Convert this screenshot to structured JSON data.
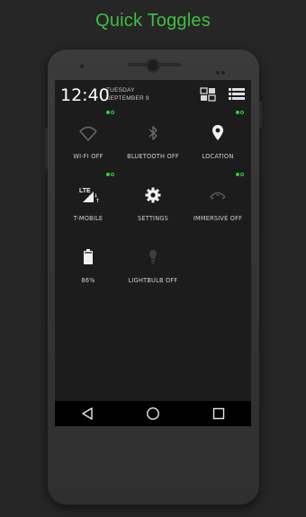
{
  "heading": "Quick Toggles",
  "colors": {
    "accent": "#3fbf3f",
    "indicator": "#2fcf3a",
    "screen_bg": "#1c1c1c"
  },
  "status_header": {
    "time": "12:40",
    "day": "TUESDAY",
    "date": "SEPTEMBER 9",
    "icons": [
      "grid-view-icon",
      "list-view-icon"
    ]
  },
  "tiles": [
    {
      "label": "WI-FI OFF",
      "icon": "wifi-icon",
      "state": "off",
      "indicator": true
    },
    {
      "label": "BLUETOOTH OFF",
      "icon": "bluetooth-icon",
      "state": "off",
      "indicator": false
    },
    {
      "label": "LOCATION",
      "icon": "location-pin-icon",
      "state": "on",
      "indicator": true
    },
    {
      "label": "T-MOBILE",
      "icon": "lte-signal-icon",
      "state": "on",
      "indicator": true
    },
    {
      "label": "SETTINGS",
      "icon": "gear-icon",
      "state": "on",
      "indicator": false
    },
    {
      "label": "IMMERSIVE OFF",
      "icon": "immersive-icon",
      "state": "off",
      "indicator": true
    },
    {
      "label": "86%",
      "icon": "battery-icon",
      "state": "on",
      "indicator": false
    },
    {
      "label": "LIGHTBULB OFF",
      "icon": "lightbulb-icon",
      "state": "off",
      "indicator": false
    }
  ],
  "nav": [
    "back-icon",
    "home-icon",
    "recents-icon"
  ]
}
